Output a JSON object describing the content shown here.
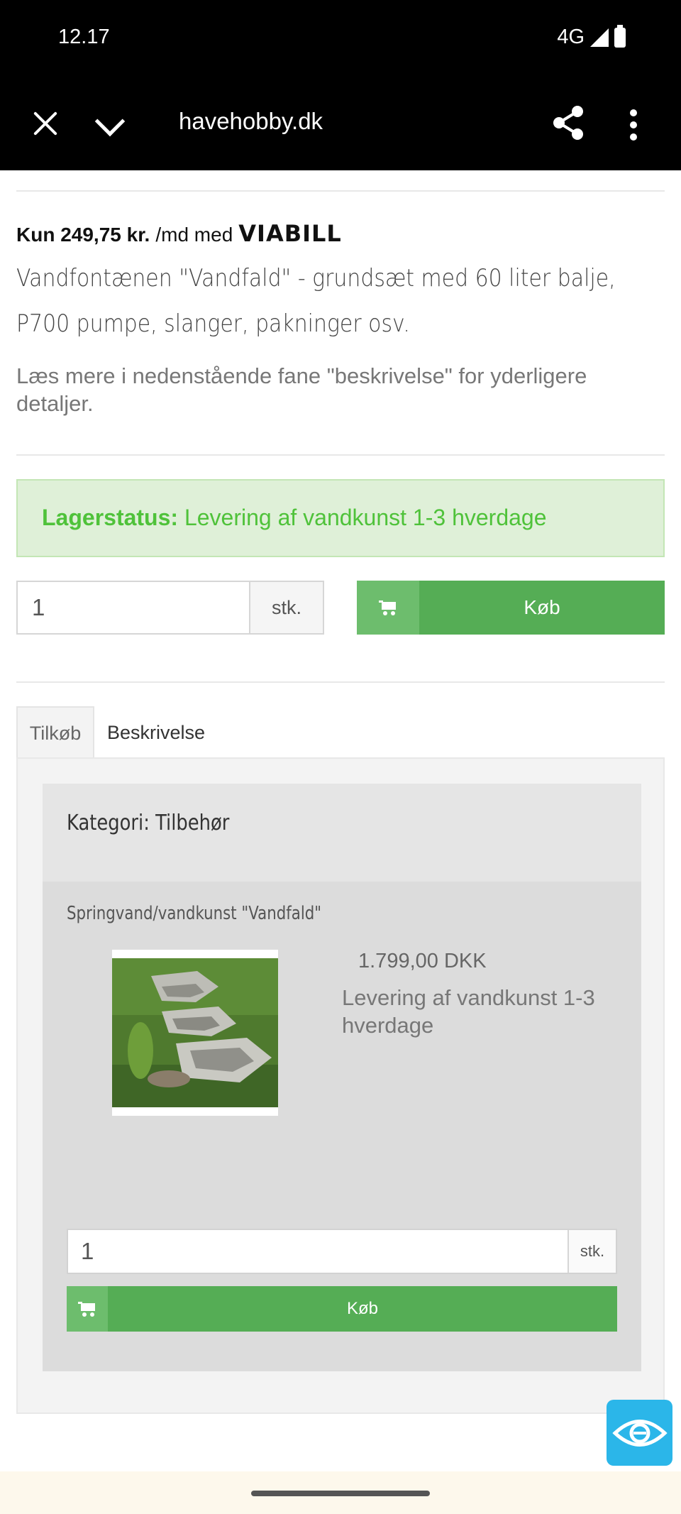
{
  "status": {
    "time": "12.17",
    "network": "4G"
  },
  "browser": {
    "url": "havehobby.dk"
  },
  "viabill": {
    "price": "Kun 249,75 kr.",
    "suffix": "/md med",
    "logo": "VIABILL"
  },
  "product": {
    "title": "Vandfontænen \"Vandfald\" - grundsæt med 60 liter balje, P700 pumpe, slanger, pakninger osv.",
    "read_more": "Læs mere i nedenstående fane \"beskrivelse\" for yderligere detaljer."
  },
  "stock": {
    "label": "Lagerstatus:",
    "value": "Levering af vandkunst 1-3 hverdage"
  },
  "order": {
    "quantity": "1",
    "unit": "stk.",
    "buy_label": "Køb"
  },
  "tabs": [
    {
      "label": "Tilkøb"
    },
    {
      "label": "Beskrivelse"
    }
  ],
  "accessory": {
    "category": "Kategori: Tilbehør",
    "item_name": "Springvand/vandkunst \"Vandfald\"",
    "price": "1.799,00 DKK",
    "stock": "Levering af vandkunst 1-3 hverdage",
    "quantity": "1",
    "unit": "stk.",
    "buy_label": "Køb"
  },
  "colors": {
    "buy_green": "#55ad55",
    "stock_green": "#4fc23a",
    "accessibility_blue": "#2bb6e9"
  },
  "icons": [
    "close-icon",
    "chevron-down-icon",
    "share-icon",
    "more-vert-icon",
    "cart-icon",
    "eye-icon"
  ]
}
